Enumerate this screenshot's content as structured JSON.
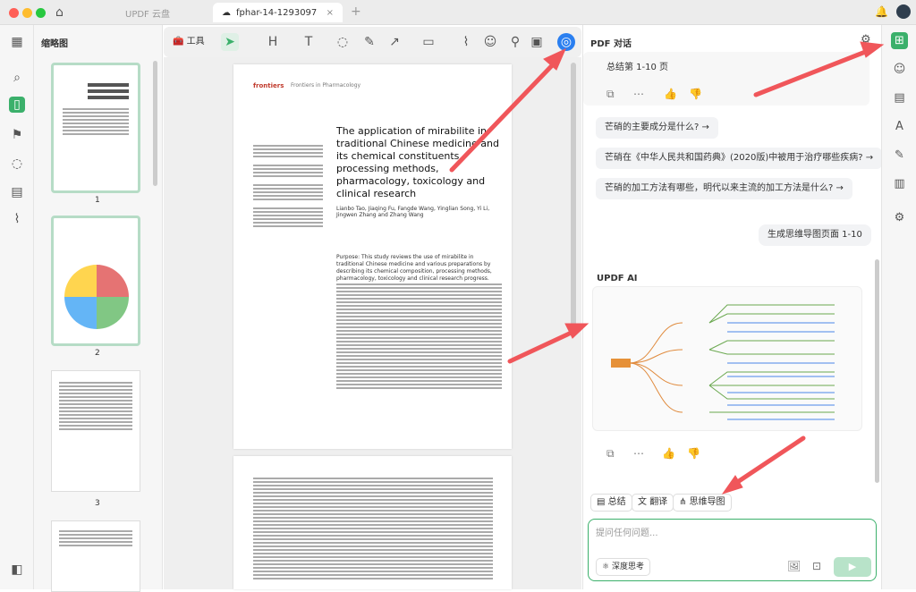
{
  "app": {
    "home_tab": "UPDF 云盘",
    "doc_tab": "fphar-14-1293097"
  },
  "colors": {
    "accent": "#3bb06b",
    "arrow": "#f0565a",
    "tool_hl": "#2a7ff0"
  },
  "thumbs": {
    "title": "缩略图",
    "labels": [
      "1",
      "2",
      "3"
    ]
  },
  "toolbar": {
    "tools_label": "工具"
  },
  "paper": {
    "journal": "Frontiers in Pharmacology",
    "title": "The application of mirabilite in traditional Chinese medicine and its chemical constituents, processing methods, pharmacology, toxicology and clinical research",
    "authors": "Lianbo Tao, Jiaqing Fu, Fangde Wang, Yinglian Song, Yi Li, Jingwen Zhang and Zhang Wang",
    "abstract": "Purpose: This study reviews the use of mirabilite in traditional Chinese medicine and various preparations by describing its chemical composition, processing methods, pharmacology, toxicology and clinical research progress."
  },
  "chat": {
    "title": "PDF 对话",
    "summary_label": "总结第 1-10 页",
    "suggestions": [
      "芒硝的主要成分是什么?",
      "芒硝在《中华人民共和国药典》(2020版)中被用于治疗哪些疾病?",
      "芒硝的加工方法有哪些，明代以来主流的加工方法是什么?"
    ],
    "user_msg": "生成思维导图页面 1-10",
    "ai_label": "UPDF AI",
    "actions": [
      "总结",
      "翻译",
      "思维导图"
    ],
    "input_placeholder": "提问任何问题...",
    "deep_think": "深度思考"
  }
}
